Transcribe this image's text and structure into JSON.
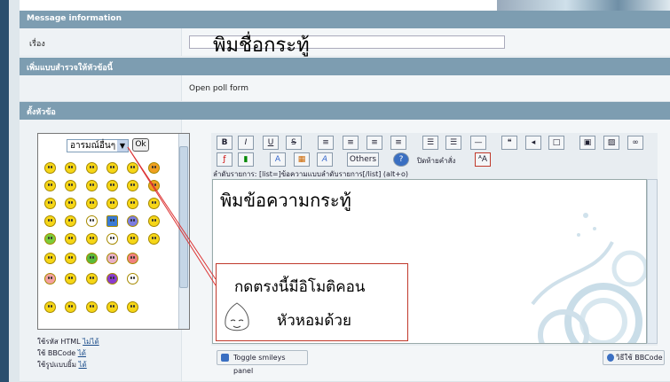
{
  "sections": {
    "message_info": "Message information",
    "add_poll": "เพิ่มแบบสำรวจให้หัวข้อนี้",
    "post_topic": "ตั้งหัวข้อ"
  },
  "subject": {
    "label": "เรื่อง",
    "annotation": "พิมชื่อกระทู้"
  },
  "poll": {
    "link": "Open poll form"
  },
  "smilies": {
    "dropdown_value": "อารมณ์อื่นๆ",
    "ok_label": "Ok"
  },
  "toolbar": {
    "bold": "B",
    "italic": "I",
    "underline": "U",
    "strike": "S",
    "others": "Others",
    "help": "?",
    "close_tags": "ปิดท้ายคำสั่ง"
  },
  "hint": "ลำดับรายการ: [list=]ข้อความแบบลำดับรายการ[/list] (alt+o)",
  "editor_annotation": "พิมข้อความกระทู้",
  "callout": {
    "line1": "กดตรงนี้มีอิโมติคอน",
    "line2": "หัวหอมด้วย"
  },
  "options": {
    "html": "ใช้รหัส HTML",
    "html_val": "ไม่ได้",
    "bbcode": "ใช้ BBCode",
    "bbcode_val": "ได้",
    "smilies": "ใช้รูปแบบยิ้ม",
    "smilies_val": "ได้"
  },
  "buttons": {
    "toggle_smileys": "Toggle smileys panel",
    "bbcode_help": "วิธีใช้ BBCode"
  }
}
